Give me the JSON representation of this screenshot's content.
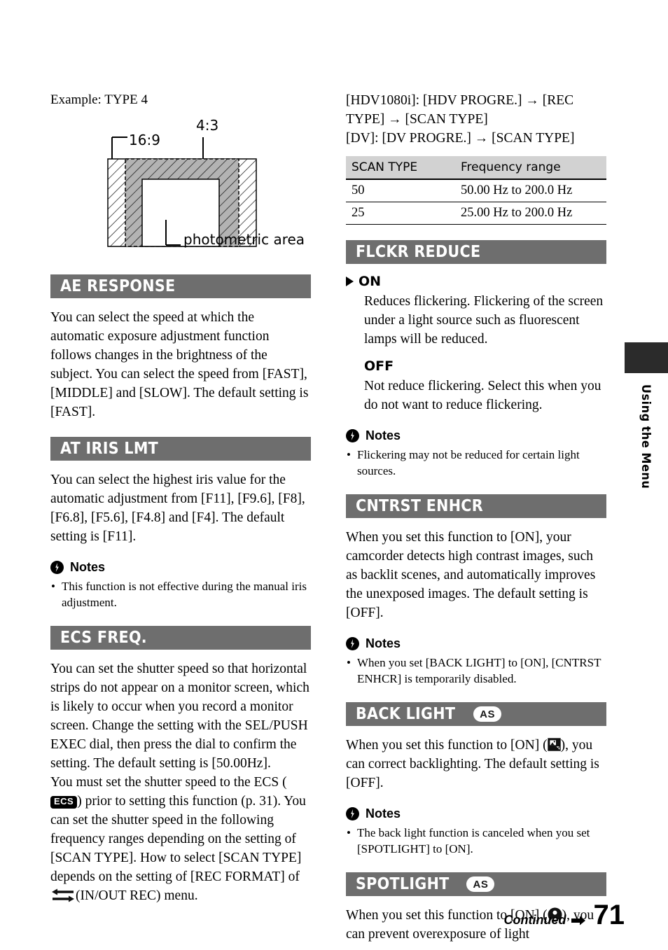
{
  "document": {
    "page_number": "71",
    "continued_label": "Continued",
    "side_tab_label": "Using the Menu"
  },
  "diagram": {
    "caption": "Example: TYPE 4",
    "label_16_9": "16:9",
    "label_4_3": "4:3",
    "label_photometric": "photometric area"
  },
  "left_column": {
    "sections": [
      {
        "id": "ae-response",
        "title": "AE RESPONSE",
        "body": "You can select the speed at which the automatic exposure adjustment function follows changes in the brightness of the subject. You can select the speed from [FAST], [MIDDLE] and [SLOW]. The default setting is [FAST]."
      },
      {
        "id": "at-iris-lmt",
        "title": "AT IRIS LMT",
        "body": "You can select the highest iris value for the automatic adjustment from [F11], [F9.6], [F8], [F6.8], [F5.6], [F4.8] and [F4]. The default setting is [F11].",
        "notes_title": "Notes",
        "notes": [
          "This function is not effective during the manual iris adjustment."
        ]
      },
      {
        "id": "ecs-freq",
        "title": "ECS FREQ.",
        "body_part1": "You can set the shutter speed so that horizontal strips do not appear on a monitor screen, which is likely to occur when you record a monitor screen. Change the setting with the SEL/PUSH EXEC dial, then press the dial to confirm the setting. The default setting is [50.00Hz].",
        "body_part2_pre": "You must set the shutter speed to the ECS (",
        "ecs_badge": "ECS",
        "body_part2_mid": ") prior to setting this function (p. 31). You can set the shutter speed in the following frequency ranges depending on the setting of [SCAN TYPE]. How to select [SCAN TYPE] depends on the setting of [REC FORMAT] of ",
        "body_part2_post": "(IN/OUT REC) menu."
      }
    ]
  },
  "right_column": {
    "intro": {
      "line1": "[HDV1080i]: [HDV PROGRE.] → [REC TYPE] → [SCAN TYPE]",
      "line2": "[DV]: [DV PROGRE.] → [SCAN TYPE]"
    },
    "scan_table": {
      "headers": [
        "SCAN TYPE",
        "Frequency range"
      ],
      "rows": [
        [
          "50",
          "50.00 Hz to 200.0 Hz"
        ],
        [
          "25",
          "25.00 Hz to 200.0 Hz"
        ]
      ]
    },
    "sections": [
      {
        "id": "flckr-reduce",
        "title": "FLCKR REDUCE",
        "options": [
          {
            "label": "ON",
            "default": true,
            "desc": "Reduces flickering. Flickering of the screen under a light source such as fluorescent lamps will be reduced."
          },
          {
            "label": "OFF",
            "default": false,
            "desc": "Not reduce flickering. Select this when you do not want to reduce flickering."
          }
        ],
        "notes_title": "Notes",
        "notes": [
          "Flickering may not be reduced for certain light sources."
        ]
      },
      {
        "id": "cntrst-enhcr",
        "title": "CNTRST ENHCR",
        "body": "When you set this function to [ON], your camcorder detects high contrast images, such as backlit scenes, and automatically improves the unexposed images. The default setting is [OFF].",
        "notes_title": "Notes",
        "notes": [
          "When you set [BACK LIGHT] to [ON], [CNTRST ENHCR] is temporarily disabled."
        ]
      },
      {
        "id": "back-light",
        "title": "BACK LIGHT",
        "badge": "AS",
        "body_pre": "When you set this function to [ON] (",
        "body_post": "), you can correct backlighting. The default setting is [OFF].",
        "notes_title": "Notes",
        "notes": [
          "The back light function is canceled when you set [SPOTLIGHT] to [ON]."
        ]
      },
      {
        "id": "spotlight",
        "title": "SPOTLIGHT",
        "badge": "AS",
        "body_pre": "When you set this function to [ON] (",
        "body_post": "), you can prevent overexposure of light"
      }
    ]
  }
}
